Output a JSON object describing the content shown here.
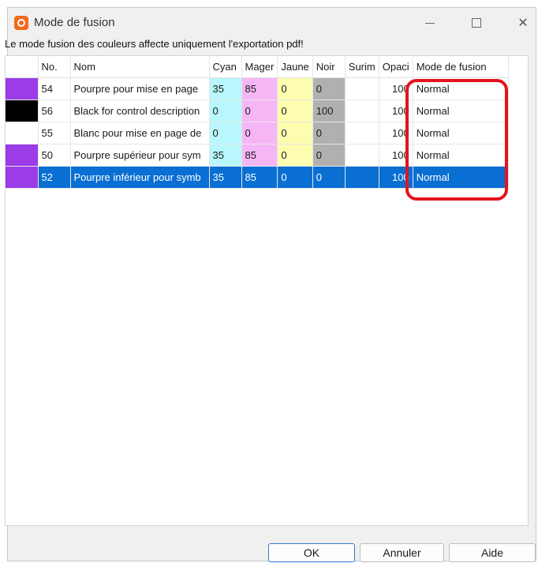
{
  "window": {
    "title": "Mode de fusion",
    "icon": "app-logo-icon"
  },
  "info_text": "Le mode fusion des couleurs affecte uniquement l'exportation pdf!",
  "table": {
    "columns": [
      "",
      "No.",
      "Nom",
      "Cyan",
      "Mager",
      "Jaune",
      "Noir",
      "Surim",
      "Opaci",
      "Mode de fusion"
    ],
    "rows": [
      {
        "swatch": "#9b3ce7",
        "no": "54",
        "nom": "Pourpre pour mise en page",
        "cyan": "35",
        "magenta": "85",
        "jaune": "0",
        "noir": "0",
        "surim": "",
        "opacite": "100",
        "mode": "Normal",
        "selected": false
      },
      {
        "swatch": "#000000",
        "no": "56",
        "nom": "Black for control description",
        "cyan": "0",
        "magenta": "0",
        "jaune": "0",
        "noir": "100",
        "surim": "",
        "opacite": "100",
        "mode": "Normal",
        "selected": false
      },
      {
        "swatch": "#ffffff",
        "no": "55",
        "nom": "Blanc pour mise en page de",
        "cyan": "0",
        "magenta": "0",
        "jaune": "0",
        "noir": "0",
        "surim": "",
        "opacite": "100",
        "mode": "Normal",
        "selected": false
      },
      {
        "swatch": "#9b3ce7",
        "no": "50",
        "nom": "Pourpre supérieur pour sym",
        "cyan": "35",
        "magenta": "85",
        "jaune": "0",
        "noir": "0",
        "surim": "",
        "opacite": "100",
        "mode": "Normal",
        "selected": false
      },
      {
        "swatch": "#9b3ce7",
        "no": "52",
        "nom": "Pourpre inférieur pour symb",
        "cyan": "35",
        "magenta": "85",
        "jaune": "0",
        "noir": "0",
        "surim": "",
        "opacite": "100",
        "mode": "Normal",
        "selected": true
      }
    ]
  },
  "buttons": {
    "ok": "OK",
    "cancel": "Annuler",
    "help": "Aide"
  },
  "colors": {
    "selection": "#0a6fd3",
    "highlight_ring": "#e4141c",
    "cyan_cell": "#b8f7fb",
    "magenta_cell": "#f6b6f6",
    "jaune_cell": "#fdfdb0",
    "noir_cell": "#b0b0b0"
  }
}
